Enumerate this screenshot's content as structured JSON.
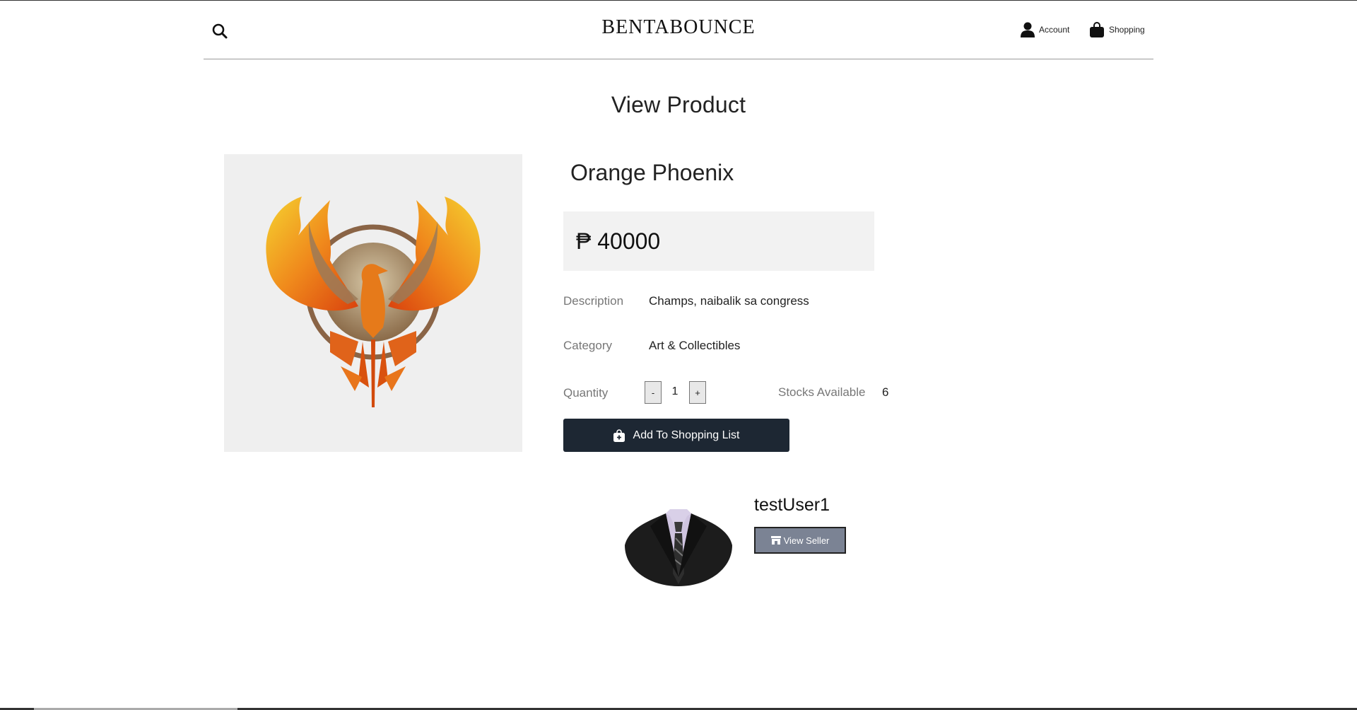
{
  "header": {
    "brand": "BENTABOUNCE",
    "search_icon": "search-icon",
    "account_label": "Account",
    "account_icon": "user-icon",
    "shopping_label": "Shopping",
    "shopping_icon": "shopping-bag-icon"
  },
  "page": {
    "title": "View Product"
  },
  "product": {
    "name": "Orange Phoenix",
    "image_icon": "phoenix-logo",
    "price": "₱ 40000",
    "description_label": "Description",
    "description": "Champs, naibalik sa congress",
    "category_label": "Category",
    "category": "Art & Collectibles",
    "quantity_label": "Quantity",
    "quantity_minus": "-",
    "quantity": "1",
    "quantity_plus": "+",
    "stocks_label": "Stocks Available",
    "stocks": "6",
    "add_button_label": "Add To Shopping List",
    "add_button_icon": "shopping-bag-plus-icon"
  },
  "seller": {
    "name": "testUser1",
    "view_button_label": "View Seller",
    "view_button_icon": "store-icon",
    "avatar_icon": "suit-avatar"
  },
  "colors": {
    "add_button_bg": "#1d2733",
    "view_seller_bg": "#7b8394",
    "price_box_bg": "#f2f2f2",
    "image_bg": "#efefef"
  }
}
